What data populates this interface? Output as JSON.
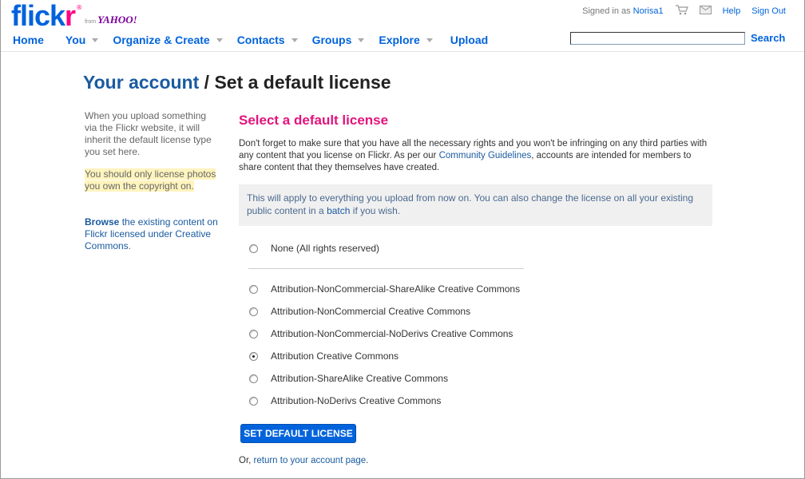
{
  "brand": {
    "logo_fl": "flick",
    "logo_r": "r",
    "reg": "®",
    "from": "from",
    "yahoo": "YAHOO!"
  },
  "topbar": {
    "signed_in_prefix": "Signed in as",
    "username": "Norisa1",
    "cart_icon": "cart-icon",
    "mail_icon": "mail-icon",
    "help": "Help",
    "sign_out": "Sign Out"
  },
  "nav": {
    "items": [
      {
        "label": "Home",
        "caret": false
      },
      {
        "label": "You",
        "caret": true
      },
      {
        "label": "Organize & Create",
        "caret": true
      },
      {
        "label": "Contacts",
        "caret": true
      },
      {
        "label": "Groups",
        "caret": true
      },
      {
        "label": "Explore",
        "caret": true
      },
      {
        "label": "Upload",
        "caret": false
      }
    ],
    "search_value": "",
    "search_label": "Search"
  },
  "page": {
    "crumb": "Your account",
    "sep": " / ",
    "title": "Set a default license"
  },
  "sidebar": {
    "info": "When you upload something via the Flickr website, it will inherit the default license type you set here.",
    "warning": "You should only license photos you own the copyright on.",
    "browse_bold": "Browse",
    "browse_rest": " the existing content on Flickr licensed under Creative Commons",
    "browse_end": "."
  },
  "main": {
    "section_title": "Select a default license",
    "intro_1": "Don't forget to make sure that you have all the necessary rights and you won't be infringing on any third parties with any content that you license on Flickr. As per our ",
    "intro_link": "Community Guidelines",
    "intro_2": ", accounts are intended for members to share content that they themselves have created.",
    "notice_1": "This will apply to everything you upload from now on. You can also change the license on all your existing public content in a ",
    "notice_link": "batch",
    "notice_2": " if you wish.",
    "options": [
      {
        "label": "None (All rights reserved)",
        "selected": false
      },
      {
        "label": "Attribution-NonCommercial-ShareAlike Creative Commons",
        "selected": false
      },
      {
        "label": "Attribution-NonCommercial Creative Commons",
        "selected": false
      },
      {
        "label": "Attribution-NonCommercial-NoDerivs Creative Commons",
        "selected": false
      },
      {
        "label": "Attribution Creative Commons",
        "selected": true
      },
      {
        "label": "Attribution-ShareAlike Creative Commons",
        "selected": false
      },
      {
        "label": "Attribution-NoDerivs Creative Commons",
        "selected": false
      }
    ],
    "submit_label": "SET DEFAULT LICENSE",
    "footer_prefix": "Or, ",
    "footer_link": "return to your account page",
    "footer_end": "."
  },
  "colors": {
    "brand_blue": "#0063dc",
    "brand_pink": "#ff0084",
    "title_pink": "#e3137c"
  }
}
